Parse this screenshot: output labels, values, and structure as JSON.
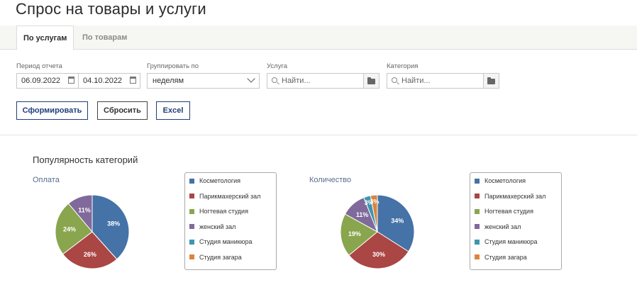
{
  "page": {
    "title": "Спрос на товары и услуги"
  },
  "tabs": [
    {
      "label": "По услугам",
      "active": true
    },
    {
      "label": "По товарам",
      "active": false
    }
  ],
  "filters": {
    "period_label": "Период отчета",
    "date_from": "06.09.2022",
    "date_to": "04.10.2022",
    "group_label": "Группировать по",
    "group_value": "неделям",
    "service_label": "Услуга",
    "service_placeholder": "Найти...",
    "category_label": "Категория",
    "category_placeholder": "Найти..."
  },
  "buttons": {
    "generate": "Сформировать",
    "reset": "Сбросить",
    "excel": "Excel"
  },
  "section_title": "Популярность категорий",
  "colors": {
    "blue": "#4572a7",
    "red": "#aa4643",
    "green": "#89a54e",
    "purple": "#80699b",
    "teal": "#3d96ae",
    "orange": "#db843d"
  },
  "chart_data": [
    {
      "type": "pie",
      "title": "Оплата",
      "legend_position": "right",
      "slices": [
        {
          "label": "Косметология",
          "value": 38,
          "color": "#4572a7",
          "data_label": "38%"
        },
        {
          "label": "Парикмахерский зал",
          "value": 26,
          "color": "#aa4643",
          "data_label": "26%"
        },
        {
          "label": "Ногтевая студия",
          "value": 24,
          "color": "#89a54e",
          "data_label": "24%"
        },
        {
          "label": "женский зал",
          "value": 11,
          "color": "#80699b",
          "data_label": "11%"
        },
        {
          "label": "Студия маникюра",
          "value": 0,
          "color": "#3d96ae",
          "data_label": ""
        },
        {
          "label": "Студия загара",
          "value": 0,
          "color": "#db843d",
          "data_label": ""
        }
      ]
    },
    {
      "type": "pie",
      "title": "Количество",
      "legend_position": "right",
      "slices": [
        {
          "label": "Косметология",
          "value": 34,
          "color": "#4572a7",
          "data_label": "34%"
        },
        {
          "label": "Парикмахерский зал",
          "value": 30,
          "color": "#aa4643",
          "data_label": "30%"
        },
        {
          "label": "Ногтевая студия",
          "value": 19,
          "color": "#89a54e",
          "data_label": "19%"
        },
        {
          "label": "женский зал",
          "value": 11,
          "color": "#80699b",
          "data_label": "11%"
        },
        {
          "label": "Студия маникюра",
          "value": 3,
          "color": "#3d96ae",
          "data_label": "3%"
        },
        {
          "label": "Студия загара",
          "value": 3,
          "color": "#db843d",
          "data_label": "3%"
        }
      ]
    }
  ]
}
